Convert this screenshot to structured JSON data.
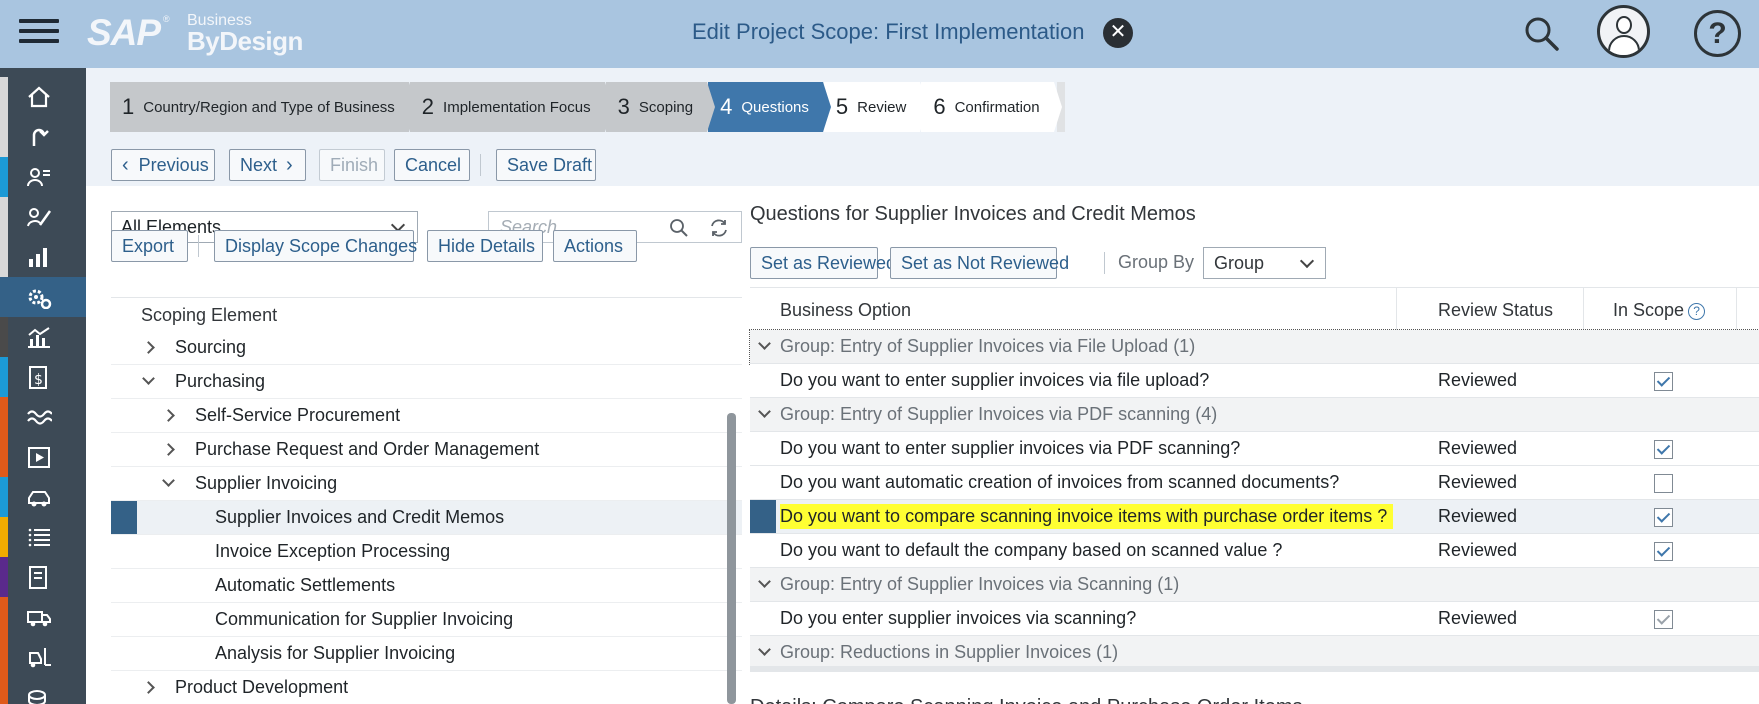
{
  "header": {
    "logo": {
      "brand": "SAP",
      "reg": "®",
      "line1": "Business",
      "line2": "ByDesign"
    },
    "title": "Edit Project Scope: First Implementation",
    "close_glyph": "✕"
  },
  "colors": {
    "header_bg": "#a9c5e0",
    "rail_bg": "#3d4a56",
    "active": "#3f77ab",
    "highlight": "#ffff33"
  },
  "rail": {
    "items": [
      {
        "icon": "home-icon",
        "strip": "#d8d8d8"
      },
      {
        "icon": "refresh-arrow-icon",
        "strip": "#d8d8d8"
      },
      {
        "icon": "person-list-icon",
        "strip": "#1c9ad6"
      },
      {
        "icon": "person-edit-icon",
        "strip": "#d8d8d8"
      },
      {
        "icon": "bar-chart-icon",
        "strip": "#d8d8d8"
      },
      {
        "icon": "gears-icon",
        "strip": "#346187"
      },
      {
        "icon": "analytics-chart-icon",
        "strip": "#4a4a4a"
      },
      {
        "icon": "document-dollar-icon",
        "strip": "#1c9ad6"
      },
      {
        "icon": "wave-icon",
        "strip": "#e05a1a"
      },
      {
        "icon": "play-icon",
        "strip": "#e05a1a"
      },
      {
        "icon": "car-icon",
        "strip": "#1c9ad6"
      },
      {
        "icon": "list-icon",
        "strip": "#f0ab00"
      },
      {
        "icon": "report-icon",
        "strip": "#5a2a8c"
      },
      {
        "icon": "truck-icon",
        "strip": "#e05a1a"
      },
      {
        "icon": "forklift-icon",
        "strip": "#e05a1a"
      },
      {
        "icon": "coins-icon",
        "strip": "#e05a1a"
      }
    ]
  },
  "roadmap": {
    "steps": [
      {
        "num": "1",
        "label": "Country/Region and Type of Business",
        "state": "done"
      },
      {
        "num": "2",
        "label": "Implementation Focus",
        "state": "done"
      },
      {
        "num": "3",
        "label": "Scoping",
        "state": "done"
      },
      {
        "num": "4",
        "label": "Questions",
        "state": "active"
      },
      {
        "num": "5",
        "label": "Review",
        "state": "future"
      },
      {
        "num": "6",
        "label": "Confirmation",
        "state": "future"
      }
    ]
  },
  "toolbar": {
    "previous": "Previous",
    "next": "Next",
    "finish": "Finish",
    "cancel": "Cancel",
    "save_draft": "Save Draft",
    "prev_glyph": "‹",
    "next_glyph": "›"
  },
  "left": {
    "filter_value": "All Elements",
    "search_placeholder": "Search",
    "buttons": {
      "export": "Export",
      "display_scope_changes": "Display Scope Changes",
      "hide_details": "Hide Details",
      "actions": "Actions"
    },
    "tree_header": "Scoping Element",
    "tree": [
      {
        "label": "Sourcing",
        "level": 1,
        "expander": "collapsed"
      },
      {
        "label": "Purchasing",
        "level": 1,
        "expander": "expanded"
      },
      {
        "label": "Self-Service Procurement",
        "level": 2,
        "expander": "collapsed"
      },
      {
        "label": "Purchase Request and Order Management",
        "level": 2,
        "expander": "collapsed"
      },
      {
        "label": "Supplier Invoicing",
        "level": 2,
        "expander": "expanded"
      },
      {
        "label": "Supplier Invoices and Credit Memos",
        "level": 3,
        "expander": "none",
        "selected": true
      },
      {
        "label": "Invoice Exception Processing",
        "level": 3,
        "expander": "none"
      },
      {
        "label": "Automatic Settlements",
        "level": 3,
        "expander": "none"
      },
      {
        "label": "Communication for Supplier Invoicing",
        "level": 3,
        "expander": "none"
      },
      {
        "label": "Analysis for Supplier Invoicing",
        "level": 3,
        "expander": "none"
      },
      {
        "label": "Product Development",
        "level": 1,
        "expander": "collapsed"
      }
    ]
  },
  "right": {
    "title": "Questions for Supplier Invoices and Credit Memos",
    "buttons": {
      "set_reviewed": "Set as Reviewed",
      "set_not_reviewed": "Set as Not Reviewed"
    },
    "group_by_label": "Group By",
    "group_by_value": "Group",
    "columns": {
      "business_option": "Business Option",
      "review_status": "Review Status",
      "in_scope": "In Scope",
      "info_glyph": "?"
    },
    "rows": [
      {
        "type": "group",
        "label": "Group: Entry of Supplier Invoices via File Upload (1)"
      },
      {
        "type": "question",
        "label": "Do you want to enter supplier invoices via file upload?",
        "status": "Reviewed",
        "in_scope": true
      },
      {
        "type": "group",
        "label": "Group: Entry of Supplier Invoices via PDF scanning (4)"
      },
      {
        "type": "question",
        "label": "Do you want to enter supplier invoices via PDF scanning?",
        "status": "Reviewed",
        "in_scope": true
      },
      {
        "type": "question",
        "label": "Do you want automatic creation of invoices from scanned documents?",
        "status": "Reviewed",
        "in_scope": false
      },
      {
        "type": "question",
        "label": "Do you want to compare scanning invoice items with purchase order items ?",
        "status": "Reviewed",
        "in_scope": true,
        "selected": true,
        "highlighted": true
      },
      {
        "type": "question",
        "label": "Do you want to default the company based on scanned value ?",
        "status": "Reviewed",
        "in_scope": true
      },
      {
        "type": "group",
        "label": "Group: Entry of Supplier Invoices via Scanning (1)"
      },
      {
        "type": "question",
        "label": "Do you enter supplier invoices via scanning?",
        "status": "Reviewed",
        "in_scope": true,
        "dim": true
      },
      {
        "type": "group",
        "label": "Group: Reductions in Supplier Invoices (1)"
      }
    ],
    "details_title": "Details: Compare Scanning Invoice and Purchase Order Items"
  }
}
